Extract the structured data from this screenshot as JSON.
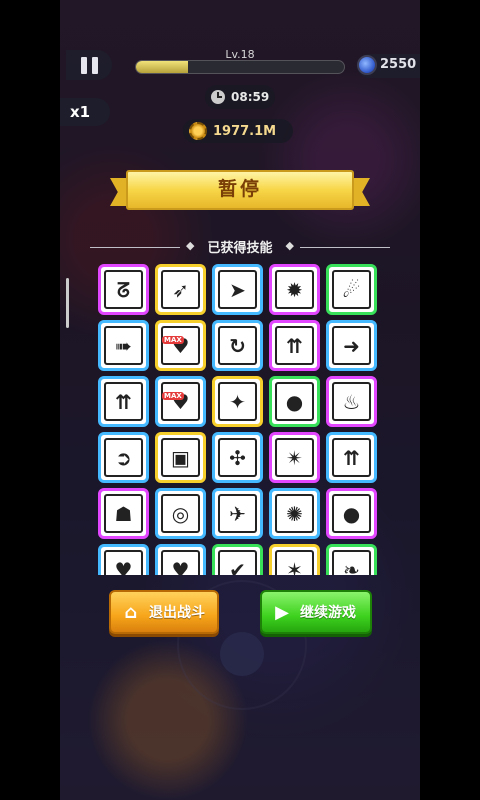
{
  "hud": {
    "level_label": "Lv.18",
    "xp_progress": 0.25,
    "gems": "2550",
    "speed": "x1",
    "timer": "08:59",
    "coins": "1977.1M"
  },
  "pause_banner": {
    "title": "暂停"
  },
  "skills": {
    "title": "已获得技能",
    "items": [
      {
        "icon": "claw-hook-icon",
        "glyph": "ᘔ",
        "border": "pink"
      },
      {
        "icon": "bow-arrow-icon",
        "glyph": "➶",
        "border": "yellow"
      },
      {
        "icon": "dash-arrow-icon",
        "glyph": "➤",
        "border": "blue"
      },
      {
        "icon": "bomb-icon",
        "glyph": "✹",
        "border": "pink"
      },
      {
        "icon": "runner-icon",
        "glyph": "☄",
        "border": "green"
      },
      {
        "icon": "blue-arrow-icon",
        "glyph": "➠",
        "border": "blue"
      },
      {
        "icon": "heart-max-icon",
        "glyph": "♥",
        "border": "yellow",
        "badge": "MAX"
      },
      {
        "icon": "swirl-icon",
        "glyph": "↻",
        "border": "blue"
      },
      {
        "icon": "triple-arrow-icon",
        "glyph": "⇈",
        "border": "pink"
      },
      {
        "icon": "yellow-arrow-icon",
        "glyph": "➜",
        "border": "blue"
      },
      {
        "icon": "double-arrow-up-icon",
        "glyph": "⇈",
        "border": "blue"
      },
      {
        "icon": "heart-max-icon",
        "glyph": "♥",
        "border": "blue",
        "badge": "MAX"
      },
      {
        "icon": "shuriken-icon",
        "glyph": "✦",
        "border": "yellow"
      },
      {
        "icon": "yellow-blob-icon",
        "glyph": "●",
        "border": "green"
      },
      {
        "icon": "fire-demon-icon",
        "glyph": "♨",
        "border": "pink"
      },
      {
        "icon": "orange-arrow-icon",
        "glyph": "➲",
        "border": "blue"
      },
      {
        "icon": "box-icon",
        "glyph": "▣",
        "border": "yellow"
      },
      {
        "icon": "tri-blade-icon",
        "glyph": "✣",
        "border": "blue"
      },
      {
        "icon": "lightning-star-icon",
        "glyph": "✴",
        "border": "pink"
      },
      {
        "icon": "double-arrow-up-icon",
        "glyph": "⇈",
        "border": "blue"
      },
      {
        "icon": "shield-man-icon",
        "glyph": "☗",
        "border": "pink"
      },
      {
        "icon": "target-icon",
        "glyph": "◎",
        "border": "blue"
      },
      {
        "icon": "jump-icon",
        "glyph": "✈",
        "border": "blue"
      },
      {
        "icon": "explosion-icon",
        "glyph": "✺",
        "border": "blue"
      },
      {
        "icon": "black-bomb-icon",
        "glyph": "●",
        "border": "pink"
      },
      {
        "icon": "heart-icon",
        "glyph": "♥",
        "border": "blue"
      },
      {
        "icon": "heart-icon",
        "glyph": "♥",
        "border": "blue"
      },
      {
        "icon": "leaf-icon",
        "glyph": "✔",
        "border": "green"
      },
      {
        "icon": "star-icon",
        "glyph": "✶",
        "border": "yellow"
      },
      {
        "icon": "feather-icon",
        "glyph": "❧",
        "border": "green"
      }
    ]
  },
  "buttons": {
    "exit_label": "退出战斗",
    "continue_label": "继续游戏"
  },
  "colors": {
    "exit_button": "#f7a51a",
    "continue_button": "#3ed21f",
    "banner": "#f7d647"
  }
}
